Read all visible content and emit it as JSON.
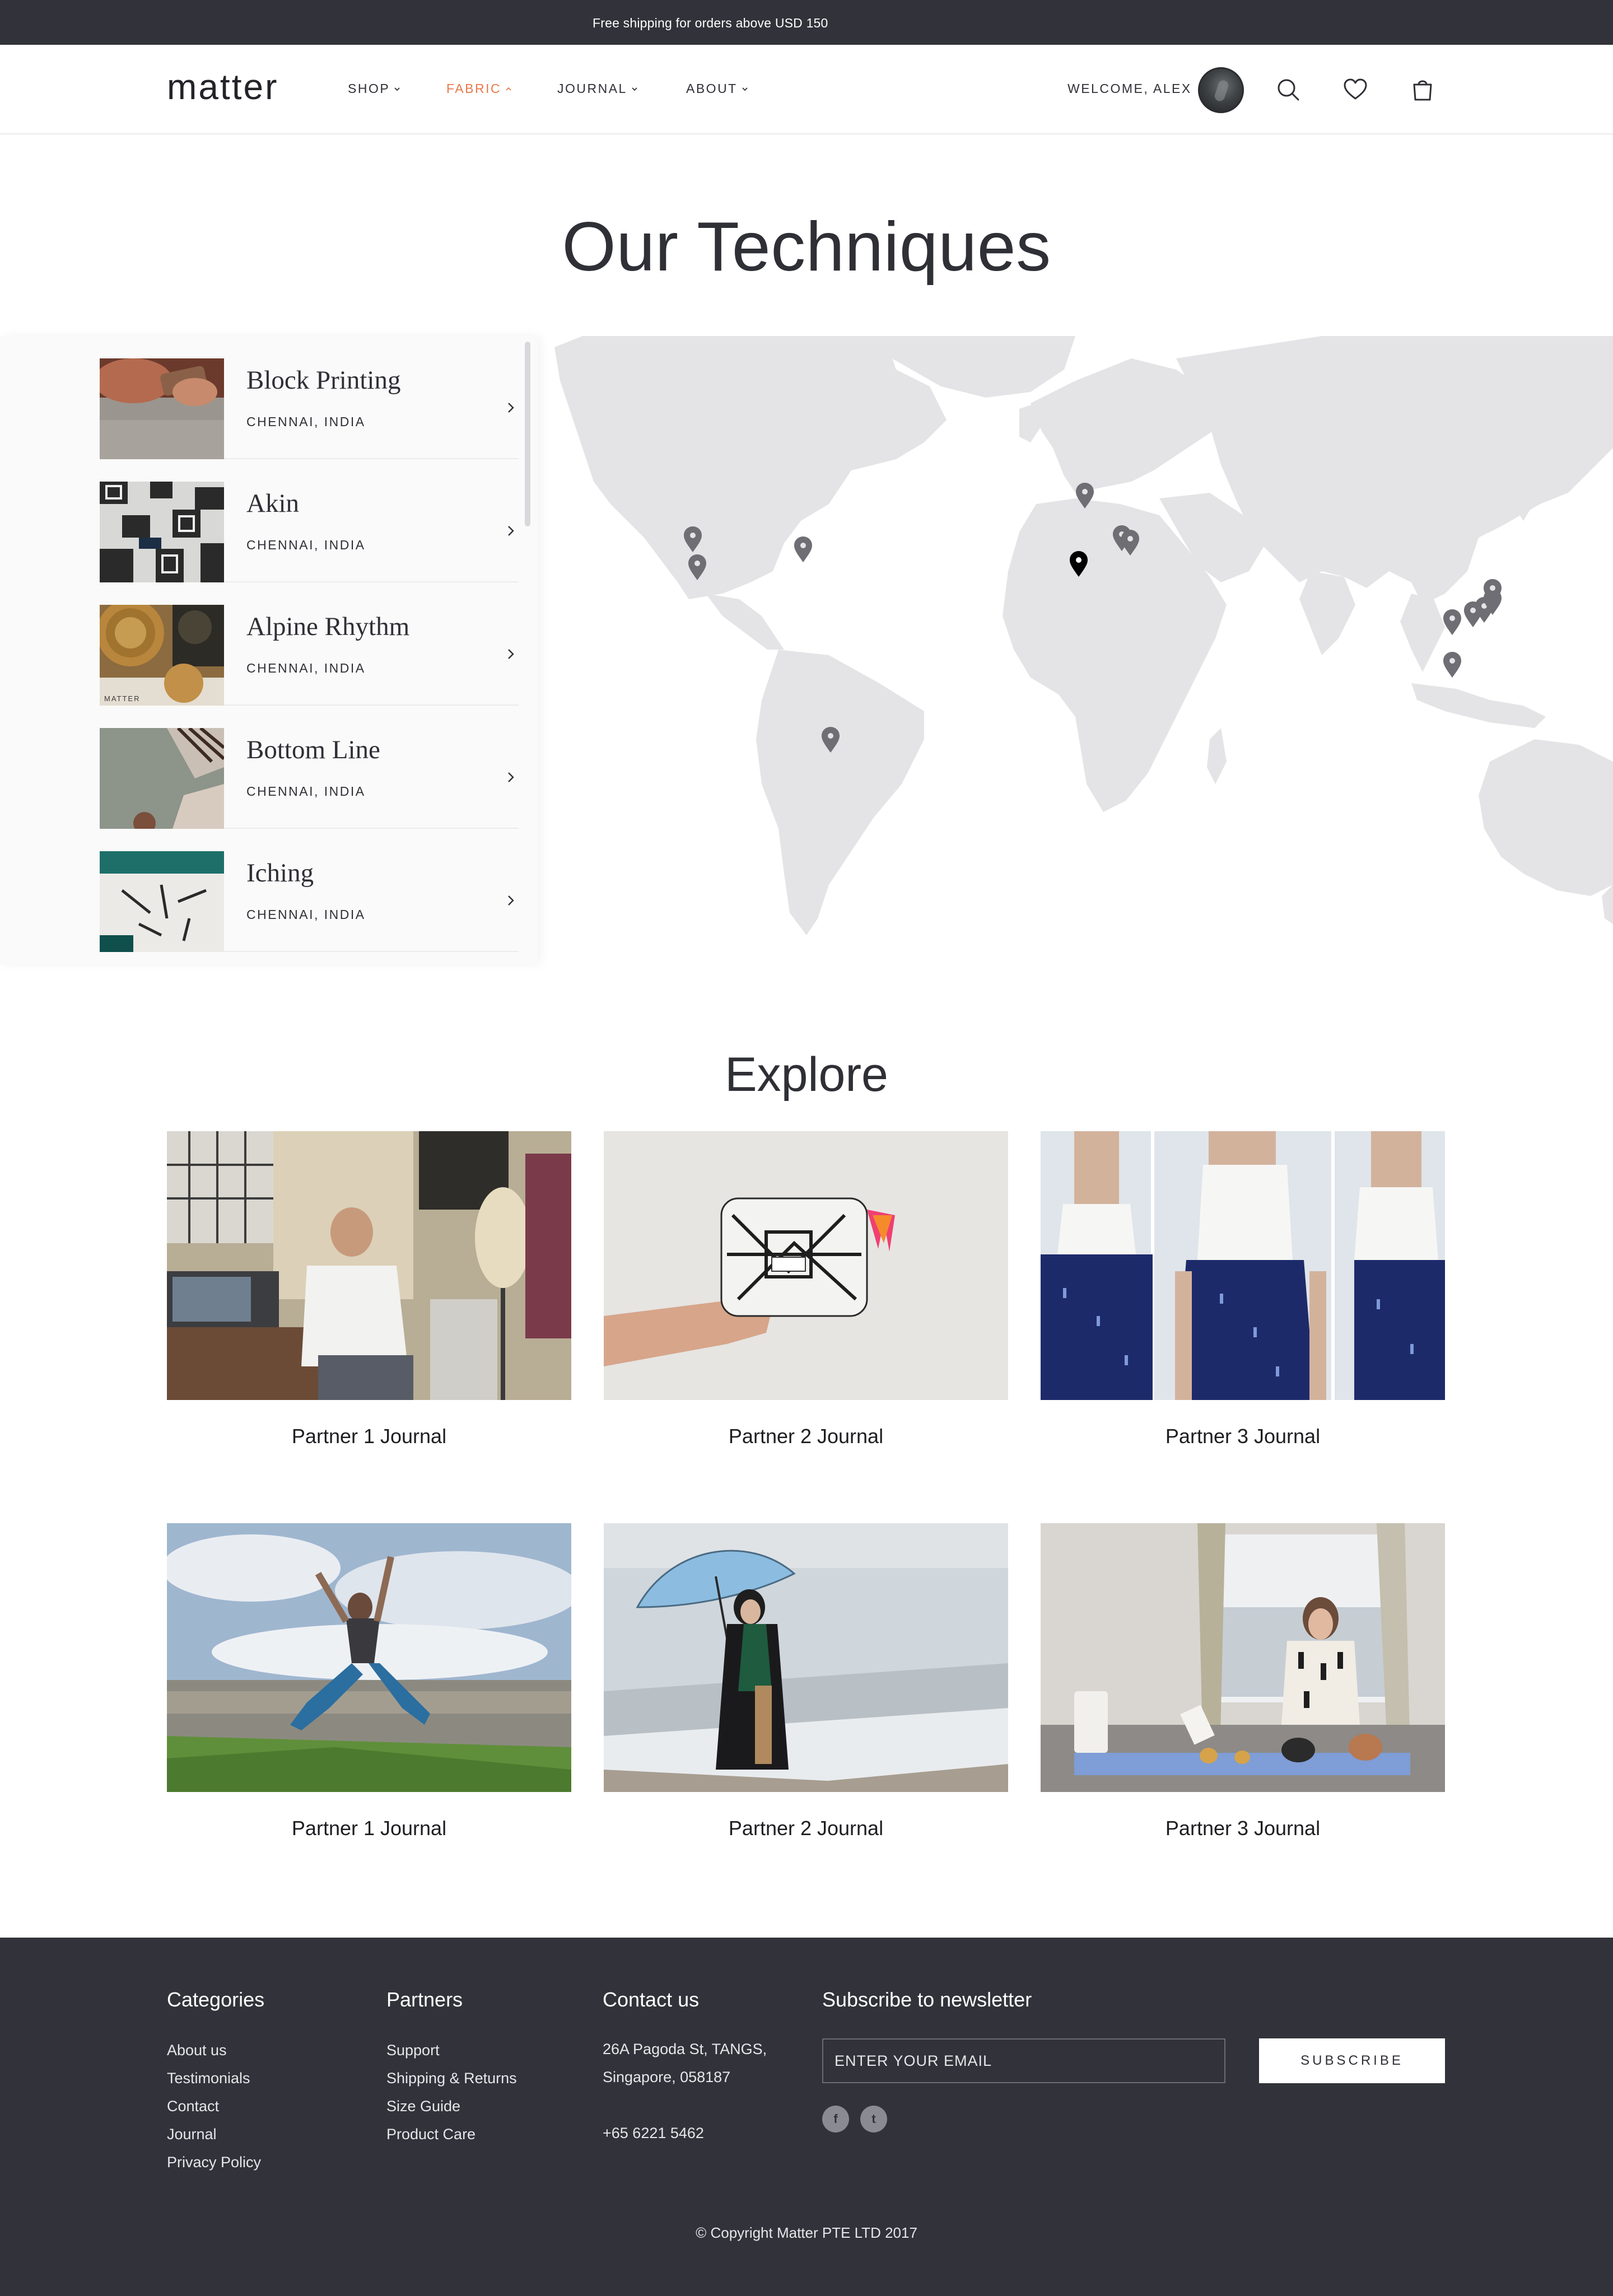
{
  "announcement": "Free shipping for orders above USD 150",
  "header": {
    "logo": "matter",
    "nav": [
      {
        "label": "SHOP"
      },
      {
        "label": "FABRIC"
      },
      {
        "label": "JOURNAL"
      },
      {
        "label": "ABOUT"
      }
    ],
    "active_nav": "FABRIC",
    "welcome": "WELCOME, ALEX"
  },
  "page_title": "Our Techniques",
  "techniques": [
    {
      "name": "Block Printing",
      "location": "CHENNAI, INDIA"
    },
    {
      "name": "Akin",
      "location": "CHENNAI, INDIA"
    },
    {
      "name": "Alpine Rhythm",
      "location": "CHENNAI, INDIA",
      "thumb_caption": "MATTER"
    },
    {
      "name": "Bottom Line",
      "location": "CHENNAI, INDIA"
    },
    {
      "name": "Iching",
      "location": "CHENNAI, INDIA"
    }
  ],
  "explore": {
    "title": "Explore",
    "cards": [
      {
        "label": "Partner 1 Journal"
      },
      {
        "label": "Partner 2 Journal"
      },
      {
        "label": "Partner 3 Journal"
      },
      {
        "label": "Partner 1 Journal"
      },
      {
        "label": "Partner 2 Journal"
      },
      {
        "label": "Partner 3 Journal"
      }
    ]
  },
  "footer": {
    "categories": {
      "title": "Categories",
      "links": [
        "About us",
        "Testimonials",
        "Contact",
        "Journal",
        "Privacy Policy"
      ]
    },
    "partners": {
      "title": "Partners",
      "links": [
        "Support",
        "Shipping & Returns",
        "Size Guide",
        "Product Care"
      ]
    },
    "contact": {
      "title": "Contact us",
      "address_line1": "26A Pagoda St, TANGS,",
      "address_line2": "Singapore, 058187",
      "phone": "+65 6221 5462"
    },
    "newsletter": {
      "title": "Subscribe to newsletter",
      "placeholder": "ENTER YOUR EMAIL",
      "button": "SUBSCRIBE"
    },
    "social": [
      {
        "icon": "facebook-icon",
        "glyph": "f"
      },
      {
        "icon": "twitter-icon",
        "glyph": "t"
      }
    ],
    "copyright": "© Copyright Matter PTE LTD  2017"
  },
  "colors": {
    "accent": "#e8794a",
    "dark": "#32323a",
    "map_land": "#e4e4e6",
    "pin": "#6e6e74",
    "pin_active": "#000000"
  }
}
